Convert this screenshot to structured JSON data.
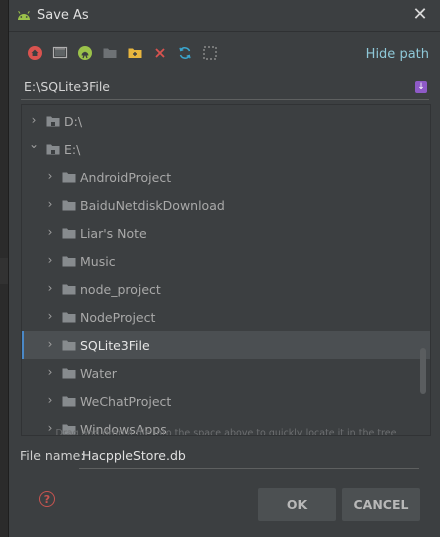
{
  "dialog": {
    "title": "Save As",
    "close_glyph": "✕",
    "hide_path_label": "Hide path"
  },
  "toolbar": {
    "icons": [
      "home-icon",
      "desktop-icon",
      "android-project-icon",
      "folder-icon",
      "new-folder-icon",
      "delete-icon",
      "refresh-icon",
      "show-hidden-icon"
    ]
  },
  "path": {
    "value": "E:\\SQLite3File"
  },
  "tree": {
    "items": [
      {
        "label": "D:\\",
        "level": 0,
        "expanded": false,
        "drive": true
      },
      {
        "label": "E:\\",
        "level": 0,
        "expanded": true,
        "drive": true
      },
      {
        "label": "AndroidProject",
        "level": 1
      },
      {
        "label": "BaiduNetdiskDownload",
        "level": 1
      },
      {
        "label": "Liar's Note",
        "level": 1
      },
      {
        "label": "Music",
        "level": 1
      },
      {
        "label": "node_project",
        "level": 1
      },
      {
        "label": "NodeProject",
        "level": 1
      },
      {
        "label": "SQLite3File",
        "level": 1,
        "selected": true
      },
      {
        "label": "Water",
        "level": 1
      },
      {
        "label": "WeChatProject",
        "level": 1
      },
      {
        "label": "WindowsApps",
        "level": 1
      }
    ],
    "hint": "Drag and drop a file into the space above to quickly locate it in the tree"
  },
  "file_name": {
    "label": "File name:",
    "value": "HacppleStore.db"
  },
  "buttons": {
    "help_glyph": "?",
    "ok_label": "OK",
    "cancel_label": "CANCEL"
  },
  "colors": {
    "accent": "#8ec8d8",
    "selection": "#4b4f52",
    "dialog_bg": "#3c3f41"
  }
}
